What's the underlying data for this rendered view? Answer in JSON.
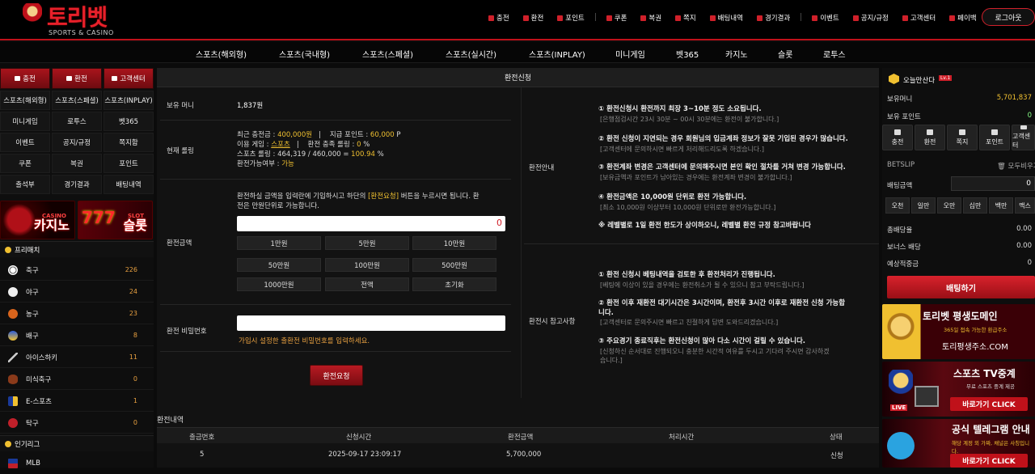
{
  "header": {
    "brand": "토리벳",
    "brand_sub": "SPORTS & CASINO",
    "nav": [
      "충전",
      "환전",
      "포인트",
      "쿠폰",
      "복권",
      "쪽지",
      "배팅내역",
      "경기결과",
      "이벤트",
      "공지/규정",
      "고객센터",
      "페이백"
    ],
    "logout": "로그아웃"
  },
  "main_nav": [
    "스포츠(해외형)",
    "스포츠(국내형)",
    "스포츠(스페셜)",
    "스포츠(실시간)",
    "스포츠(INPLAY)",
    "미니게임",
    "벳365",
    "카지노",
    "슬롯",
    "로투스"
  ],
  "left": {
    "top_buttons": [
      "충전",
      "환전",
      "고객센터"
    ],
    "grid": [
      "스포츠(해외형)",
      "스포츠(스페셜)",
      "스포츠(INPLAY)",
      "미니게임",
      "로투스",
      "벳365",
      "이벤트",
      "공지/규정",
      "쪽지함",
      "쿠폰",
      "복권",
      "포인트",
      "출석부",
      "경기결과",
      "배팅내역"
    ],
    "banner_casino": {
      "small": "CASINO",
      "big": "카지노"
    },
    "banner_slot": {
      "small": "SLOT",
      "big": "슬롯"
    },
    "prematch_title": "프리매치",
    "sports": [
      {
        "name": "축구",
        "count": "226"
      },
      {
        "name": "야구",
        "count": "24"
      },
      {
        "name": "농구",
        "count": "23"
      },
      {
        "name": "배구",
        "count": "8"
      },
      {
        "name": "아이스하키",
        "count": "11"
      },
      {
        "name": "미식축구",
        "count": "0"
      },
      {
        "name": "E-스포츠",
        "count": "1"
      },
      {
        "name": "탁구",
        "count": "0"
      }
    ],
    "popular_title": "인기리그",
    "popular_first": "MLB"
  },
  "center": {
    "title": "환전신청",
    "money_label": "보유 머니",
    "money_value": "1,837원",
    "rolling_label": "현재 롤링",
    "rolling": {
      "l1a": "최근 충전금 : ",
      "l1b": "400,000원",
      "l1c": "   |    지급 포인트 : ",
      "l1d": "60,000",
      "l1e": " P",
      "l2a": "이용 게임 : ",
      "l2b": "스포츠",
      "l2c": "   |    환전 충족 롤링 : ",
      "l2d": "0",
      "l2e": " %",
      "l3a": "스포츠 롤링 : 464,319 / 460,000 = ",
      "l3b": "100.94",
      "l3c": " %",
      "l4a": "환전가능여부 : ",
      "l4b": "가능"
    },
    "amount_label": "환전금액",
    "amount_desc_a": "환전하실 금액을 입력란에 기입하시고 하단의 ",
    "amount_desc_b": "[환전요청]",
    "amount_desc_c": " 버튼을 누르시면 됩니다. 환",
    "amount_desc_d": "전은 만원단위로 가능합니다.",
    "amount_value": "0",
    "amount_buttons": [
      "1만원",
      "5만원",
      "10만원",
      "50만원",
      "100만원",
      "500만원",
      "1000만원",
      "전액",
      "초기화"
    ],
    "pw_label": "환전 비밀번호",
    "pw_hint": "가입시 설정한 출환전 비밀번호를 입력하세요.",
    "submit": "환전요청",
    "guide_label": "환전안내",
    "guide": [
      {
        "t": "① 환전신청시 환전까지 최장 3~10분 정도 소요됩니다.",
        "g": "[은행점검시간 23시 30분 ~ 00시 30분에는 환전이 불가합니다.]"
      },
      {
        "t": "② 환전 신청이 지연되는 경우 회원님의 입금계좌 정보가 잘못 기입된 경우가 많습니다.",
        "g": "[고객센터에 문의하시면 빠르게 처리해드리도록 하겠습니다.]"
      },
      {
        "t": "③ 환전계좌 변경은 고객센터에 문의해주시면 본인 확인 절차를 거쳐 변경 가능합니다.",
        "g": "[보유금액과 포인트가 남아있는 경우에는 환전계좌 변경이 불가합니다.]"
      },
      {
        "t": "④ 환전금액은 10,000원 단위로 환전 가능합니다.",
        "g": "[최소 10,000원 이상부터 10,000원 단위로만 환전가능합니다.]"
      },
      {
        "t": "※ 레벨별로 1일 환전 한도가 상이하오니, 레벨별 환전 규정 참고바랍니다",
        "g": ""
      }
    ],
    "notes_label": "환전시 참고사항",
    "notes": [
      {
        "t": "① 환전 신청시 베팅내역을 검토한 후 환전처리가 진행됩니다.",
        "g": "[베팅에 이상이 있을 경우에는 환전취소가 될 수 있으니 참고 부탁드립니다.]"
      },
      {
        "t": "② 환전 이후 재환전 대기시간은 3시간이며, 환전후 3시간 이후로 재환전 신청 가능합",
        "t2": "니다.",
        "g": "[고객센터로 문의주시면 빠르고 친절하게 답변 도와드리겠습니다.]"
      },
      {
        "t": "③ 주요경기 종료직후는 환전신청이 많아 다소 시간이 걸릴 수 있습니다.",
        "g": "[신청하신 순서대로 진행되오니 충분한 시간적 여유를 두시고 기다려 주시면 감사하겠",
        "g2": "습니다.]"
      }
    ],
    "history": {
      "title": "환전내역",
      "headers": [
        "출금번호",
        "신청시간",
        "환전금액",
        "처리시간",
        "상태"
      ],
      "row": [
        "5",
        "2025-09-17 23:09:17",
        "5,700,000",
        "",
        "신청"
      ]
    }
  },
  "right": {
    "user_msg": "오늘만산다",
    "level": "Lv.1",
    "money_label": "보유머니",
    "money_value": "5,701,837",
    "point_label": "보유 포인트",
    "point_value": "0",
    "buttons": [
      "충전",
      "환전",
      "쪽지",
      "포인트",
      "고객센터"
    ],
    "betslip": "BETSLIP",
    "clear_all": "모두비우기",
    "bet_amount_label": "배팅금액",
    "bet_amount_value": "0",
    "chips": [
      "오천",
      "일만",
      "오만",
      "십만",
      "백만",
      "맥스"
    ],
    "total_odds_label": "총배당율",
    "total_odds_value": "0.00",
    "bonus_label": "보너스 배당",
    "bonus_value": "0.00",
    "expected_label": "예상적중금",
    "expected_value": "0",
    "bet_button": "배팅하기",
    "promo1": {
      "title": "토리벳 평생도메인",
      "sub": "365일 접속 가능한 환급주소",
      "url": "토리평생주소.COM"
    },
    "promo2": {
      "title": "스포츠 TV중계",
      "sub": "무료 스포츠 중계 제공",
      "cta": "바로가기 CLICK",
      "badge": "LIVE"
    },
    "promo3": {
      "title": "공식 텔레그램 안내",
      "sub": "해당 계정 외 가짜, 채널은 사칭입니다.",
      "cta": "바로가기 CLICK"
    }
  },
  "colors": {
    "accent": "#d0202a",
    "gold": "#f0c030",
    "panel": "#121212"
  }
}
